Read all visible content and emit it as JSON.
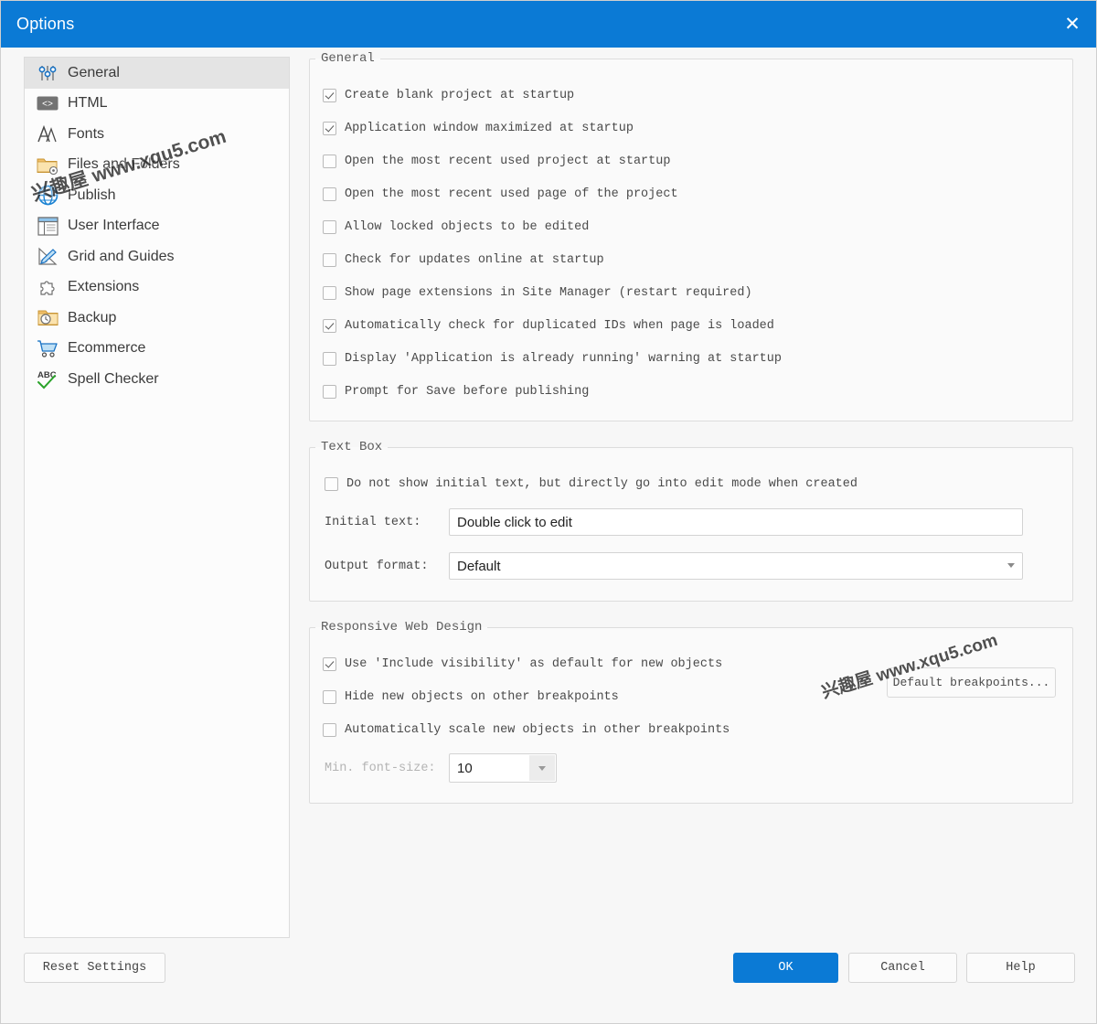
{
  "window": {
    "title": "Options",
    "close_icon": "close-icon"
  },
  "sidebar": {
    "items": [
      {
        "label": "General",
        "icon": "sliders-icon",
        "selected": true
      },
      {
        "label": "HTML",
        "icon": "code-tag-icon",
        "selected": false
      },
      {
        "label": "Fonts",
        "icon": "font-aa-icon",
        "selected": false
      },
      {
        "label": "Files and Folders",
        "icon": "folder-gear-icon",
        "selected": false
      },
      {
        "label": "Publish",
        "icon": "globe-icon",
        "selected": false
      },
      {
        "label": "User Interface",
        "icon": "window-layout-icon",
        "selected": false
      },
      {
        "label": "Grid and Guides",
        "icon": "ruler-pencil-icon",
        "selected": false
      },
      {
        "label": "Extensions",
        "icon": "puzzle-piece-icon",
        "selected": false
      },
      {
        "label": "Backup",
        "icon": "folder-clock-icon",
        "selected": false
      },
      {
        "label": "Ecommerce",
        "icon": "shopping-cart-icon",
        "selected": false
      },
      {
        "label": "Spell Checker",
        "icon": "abc-check-icon",
        "selected": false
      }
    ]
  },
  "general_group": {
    "legend": "General",
    "checkboxes": [
      {
        "label": "Create blank project at startup",
        "checked": true
      },
      {
        "label": "Application window maximized at startup",
        "checked": true
      },
      {
        "label": "Open the most recent used project at startup",
        "checked": false
      },
      {
        "label": "Open the most recent used page of the project",
        "checked": false
      },
      {
        "label": "Allow locked objects to be edited",
        "checked": false
      },
      {
        "label": "Check for updates online at startup",
        "checked": false
      },
      {
        "label": "Show page extensions in Site Manager (restart required)",
        "checked": false
      },
      {
        "label": "Automatically check for duplicated IDs when page is loaded",
        "checked": true
      },
      {
        "label": "Display 'Application is already running' warning at startup",
        "checked": false
      },
      {
        "label": "Prompt for Save before publishing",
        "checked": false
      }
    ]
  },
  "textbox_group": {
    "legend": "Text Box",
    "checkbox": {
      "label": "Do not show initial text, but directly go into edit mode when created",
      "checked": false
    },
    "initial_text_label": "Initial text:",
    "initial_text_value": "Double click to edit",
    "output_format_label": "Output format:",
    "output_format_value": "Default"
  },
  "rwd_group": {
    "legend": "Responsive Web Design",
    "checkboxes": [
      {
        "label": "Use 'Include visibility' as default for new objects",
        "checked": true
      },
      {
        "label": "Hide new objects on other breakpoints",
        "checked": false
      },
      {
        "label": "Automatically scale new objects in other breakpoints",
        "checked": false
      }
    ],
    "min_font_label": "Min. font-size:",
    "min_font_value": "10",
    "default_breakpoints_button": "Default breakpoints..."
  },
  "footer": {
    "reset_label": "Reset Settings",
    "ok_label": "OK",
    "cancel_label": "Cancel",
    "help_label": "Help"
  },
  "watermarks": {
    "one": "兴趣屋 www.xqu5.com",
    "two": "兴趣屋 www.xqu5.com"
  },
  "colors": {
    "titlebar": "#0b7ad5",
    "accent": "#0b7ad5",
    "panel": "#fafafa",
    "selected_row": "#e4e4e4"
  }
}
